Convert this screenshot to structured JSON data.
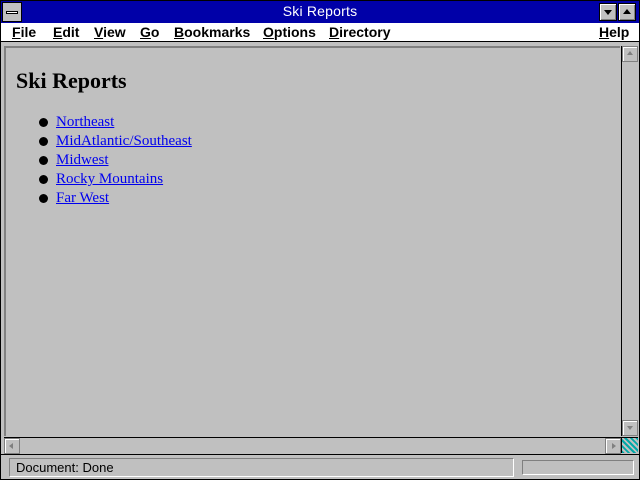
{
  "window": {
    "title": "Ski Reports"
  },
  "menubar": {
    "items": [
      {
        "first": "F",
        "rest": "ile"
      },
      {
        "first": "E",
        "rest": "dit"
      },
      {
        "first": "V",
        "rest": "iew"
      },
      {
        "first": "G",
        "rest": "o"
      },
      {
        "first": "B",
        "rest": "ookmarks"
      },
      {
        "first": "O",
        "rest": "ptions"
      },
      {
        "first": "D",
        "rest": "irectory"
      },
      {
        "first": "H",
        "rest": "elp"
      }
    ]
  },
  "page": {
    "heading": "Ski Reports",
    "links": [
      "Northeast",
      "MidAtlantic/Southeast",
      "Midwest",
      "Rocky Mountains",
      "Far West"
    ],
    "link_color": "#0000ee"
  },
  "statusbar": {
    "text": "Document: Done"
  },
  "colors": {
    "titlebar": "#0000a8",
    "background": "#c0c0c0"
  }
}
